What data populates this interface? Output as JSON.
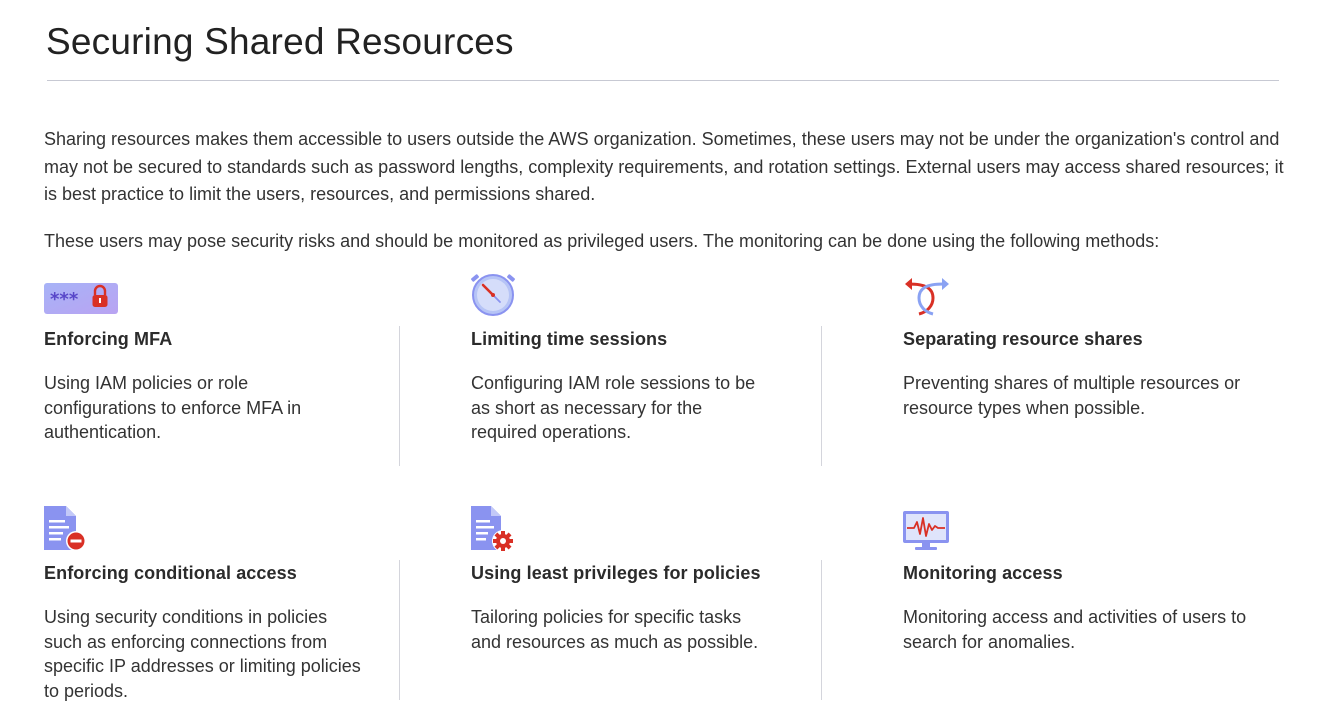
{
  "page": {
    "title": "Securing Shared Resources",
    "intro_paragraph": "Sharing resources makes them accessible to users outside the AWS organization. Sometimes, these users may not be under the organization's control and may not be secured to standards such as password lengths, complexity requirements, and rotation settings. External users may access shared resources; it is best practice to limit the users, resources, and permissions shared.",
    "methods_intro": "These users may pose security risks and should be monitored as privileged users. The monitoring can be done using the following methods:"
  },
  "methods": [
    {
      "icon": "password-lock-icon",
      "title": "Enforcing MFA",
      "description": "Using IAM policies or role configurations to enforce MFA in authentication."
    },
    {
      "icon": "stopwatch-icon",
      "title": "Limiting time sessions",
      "description": "Configuring IAM role sessions to be as short as necessary for the required operations."
    },
    {
      "icon": "split-arrows-icon",
      "title": "Separating resource shares",
      "description": "Preventing shares of multiple resources or resource types when possible."
    },
    {
      "icon": "document-block-icon",
      "title": "Enforcing conditional access",
      "description": "Using security conditions in policies such as enforcing connections from specific IP addresses or limiting policies to periods."
    },
    {
      "icon": "document-gear-icon",
      "title": "Using least privileges for policies",
      "description": "Tailoring policies for specific tasks and resources as much as possible."
    },
    {
      "icon": "monitor-pulse-icon",
      "title": "Monitoring access",
      "description": "Monitoring access and activities of users to search for anomalies."
    }
  ],
  "colors": {
    "accent_purple": "#8a93f0",
    "accent_red": "#d93025",
    "text": "#333333",
    "rule": "#c7c9d3"
  }
}
